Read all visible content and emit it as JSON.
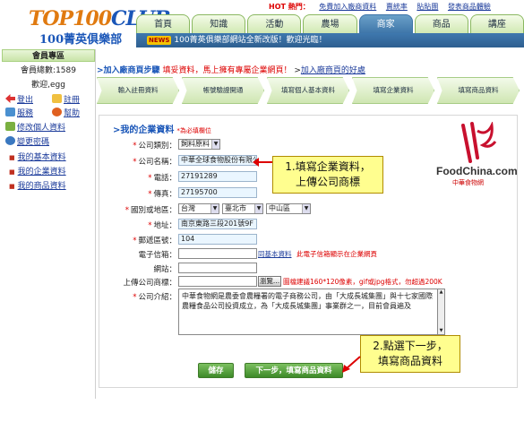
{
  "logo": {
    "brand": "TOP100",
    "brand_suffix": "CLUB",
    "subtitle": "100菁英俱樂部"
  },
  "hotbar": {
    "label": "HOT 熱門：",
    "links": [
      "免費加入廠商資料",
      "賣統率",
      "貼貼團",
      "發表商品體驗"
    ]
  },
  "nav": {
    "tabs": [
      "首頁",
      "知識",
      "活動",
      "農場",
      "商家",
      "商品",
      "講座"
    ],
    "active": "商家"
  },
  "news": {
    "badge": "NEWS",
    "text": "100菁英俱樂部網站全新改版！歡迎光臨！"
  },
  "sidebar": {
    "title": "會員專區",
    "member_total_label": "會員總數:1589",
    "greeting": "歡迎,egg",
    "logout": "登出",
    "register": "註冊",
    "service": "服務",
    "help": "幫助",
    "edit_profile": "修改個人資料",
    "change_password": "變更密碼",
    "menu": [
      "我的基本資料",
      "我的企業資料",
      "我的商品資料"
    ]
  },
  "steps": {
    "title": "加入廠商頁步驟",
    "title_note": "填妥資料，馬上擁有專屬企業網頁！",
    "title_link": "加入廠商頁的好處",
    "items": [
      "輸入註冊資料",
      "帳號驗證開通",
      "填寫個人基本資料",
      "填寫企業資料",
      "填寫商品資料"
    ]
  },
  "form": {
    "title": ">我的企業資料",
    "required_note": "*為必填欄位",
    "fields": {
      "category": {
        "label": "公司類別：",
        "value": "飼料原料"
      },
      "company_name": {
        "label": "公司名稱：",
        "value": "中華全球食物股份有限公司"
      },
      "phone": {
        "label": "電話：",
        "value": "27191289"
      },
      "fax": {
        "label": "傳真：",
        "value": "27195700"
      },
      "region": {
        "label": "國別或地區：",
        "country": "台灣",
        "city": "臺北市",
        "district": "中山區"
      },
      "address": {
        "label": "地址：",
        "value": "南京東路三段201號9F"
      },
      "zip": {
        "label": "郵遞區號：",
        "value": "104"
      },
      "email": {
        "label": "電子信箱：",
        "value": "",
        "link": "同基本資料",
        "note": "此電子信箱顯示在企業網頁"
      },
      "website": {
        "label": "網站：",
        "value": ""
      },
      "logo_upload": {
        "label": "上傳公司商標：",
        "button": "瀏覽...",
        "note": "圖檔建議160*120像素，gif或jpg格式，勿超過200K"
      },
      "intro": {
        "label": "公司介紹：",
        "value": "中華食物網是農委會農糧署的電子商務公司，由「大成長城集團」與十七家國際農糧食品公司投資成立，為「大成長城集團」事業群之一，目前會員遍及"
      }
    },
    "save_button": "儲存",
    "next_button": "下一步，填寫商品資料"
  },
  "callouts": {
    "one_line1": "1.填寫企業資料，",
    "one_line2": "上傳公司商標",
    "two_line1": "2.點選下一步，",
    "two_line2": "填寫商品資料"
  },
  "company_logo": {
    "text": "FoodChina.com",
    "sub": "中華食物網"
  }
}
